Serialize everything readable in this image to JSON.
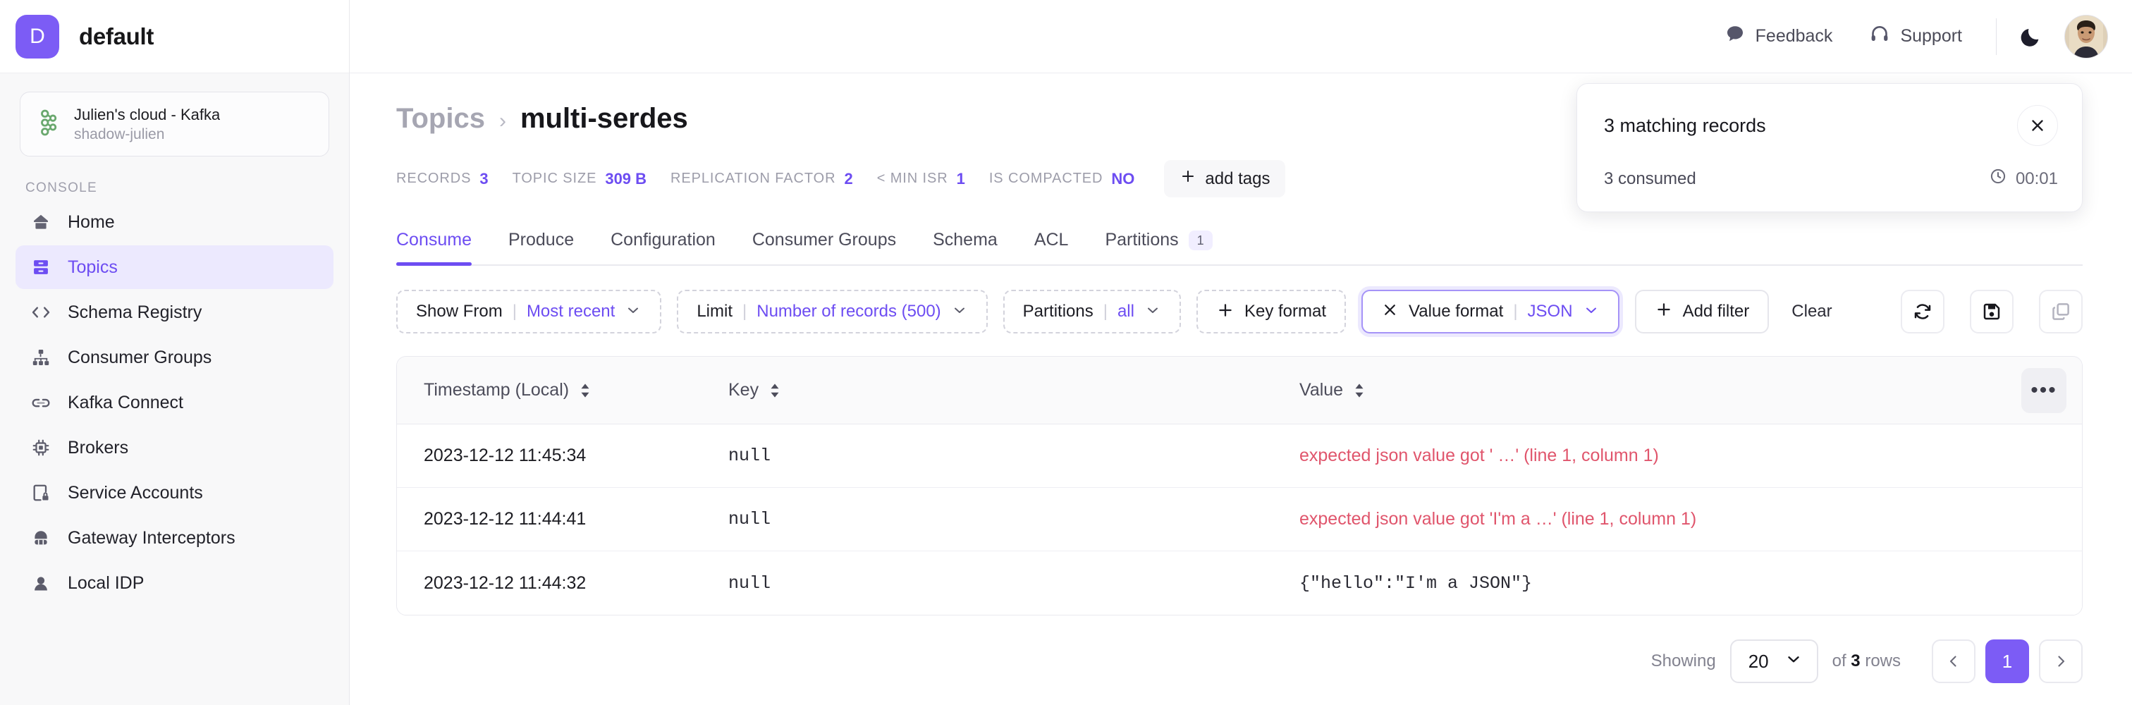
{
  "brand": {
    "initial": "D",
    "name": "default"
  },
  "cluster": {
    "title": "Julien's cloud - Kafka",
    "subtitle": "shadow-julien",
    "icon": "kafka-icon"
  },
  "sidebar": {
    "section_label": "CONSOLE",
    "items": [
      {
        "label": "Home",
        "icon": "home-icon",
        "active": false
      },
      {
        "label": "Topics",
        "icon": "topics-icon",
        "active": true
      },
      {
        "label": "Schema Registry",
        "icon": "code-brackets-icon",
        "active": false
      },
      {
        "label": "Consumer Groups",
        "icon": "hierarchy-icon",
        "active": false
      },
      {
        "label": "Kafka Connect",
        "icon": "link-icon",
        "active": false
      },
      {
        "label": "Brokers",
        "icon": "chip-icon",
        "active": false
      },
      {
        "label": "Service Accounts",
        "icon": "device-lock-icon",
        "active": false
      },
      {
        "label": "Gateway Interceptors",
        "icon": "gateway-icon",
        "active": false
      },
      {
        "label": "Local IDP",
        "icon": "idp-icon",
        "active": false
      }
    ]
  },
  "topbar": {
    "feedback_label": "Feedback",
    "support_label": "Support",
    "feedback_icon": "chat-bubble-icon",
    "support_icon": "headset-icon",
    "theme_icon": "moon-icon",
    "avatar_name": "user-avatar"
  },
  "breadcrumb": {
    "parent": "Topics",
    "separator": "›",
    "current": "multi-serdes"
  },
  "meta": [
    {
      "key": "RECORDS",
      "value": "3"
    },
    {
      "key": "TOPIC SIZE",
      "value": "309 B"
    },
    {
      "key": "REPLICATION FACTOR",
      "value": "2"
    },
    {
      "key": "< MIN ISR",
      "value": "1"
    },
    {
      "key": "IS COMPACTED",
      "value": "NO"
    }
  ],
  "add_tags_label": "add tags",
  "tabs": [
    {
      "label": "Consume",
      "active": true,
      "badge": null
    },
    {
      "label": "Produce",
      "active": false,
      "badge": null
    },
    {
      "label": "Configuration",
      "active": false,
      "badge": null
    },
    {
      "label": "Consumer Groups",
      "active": false,
      "badge": null
    },
    {
      "label": "Schema",
      "active": false,
      "badge": null
    },
    {
      "label": "ACL",
      "active": false,
      "badge": null
    },
    {
      "label": "Partitions",
      "active": false,
      "badge": "1"
    }
  ],
  "toolbar": {
    "filters": [
      {
        "style": "dashed",
        "lead_icon": null,
        "key": "Show From",
        "value": "Most recent",
        "caret": true
      },
      {
        "style": "dashed",
        "lead_icon": null,
        "key": "Limit",
        "value": "Number of records (500)",
        "caret": true
      },
      {
        "style": "dashed",
        "lead_icon": null,
        "key": "Partitions",
        "value": "all",
        "caret": true
      },
      {
        "style": "dashed",
        "lead_icon": "plus-icon",
        "key": "Key format",
        "value": null,
        "caret": false
      },
      {
        "style": "selected",
        "lead_icon": "x-icon",
        "key": "Value format",
        "value": "JSON",
        "caret": true
      }
    ],
    "add_filter_label": "Add filter",
    "clear_label": "Clear",
    "actions": [
      {
        "icon": "refresh-icon",
        "name": "refresh-button"
      },
      {
        "icon": "save-icon",
        "name": "save-button"
      },
      {
        "icon": "copy-icon",
        "name": "copy-button"
      }
    ]
  },
  "table": {
    "columns": [
      {
        "label": "Timestamp (Local)",
        "sortable": true
      },
      {
        "label": "Key",
        "sortable": true
      },
      {
        "label": "Value",
        "sortable": true
      }
    ],
    "more_label": "•••",
    "rows": [
      {
        "timestamp": "2023-12-12 11:45:34",
        "key": "null",
        "value": "expected json value got '  …' (line 1, column 1)",
        "value_is_error": true
      },
      {
        "timestamp": "2023-12-12 11:44:41",
        "key": "null",
        "value": "expected json value got 'I'm a …' (line 1, column 1)",
        "value_is_error": true
      },
      {
        "timestamp": "2023-12-12 11:44:32",
        "key": "null",
        "value": "{\"hello\":\"I'm a JSON\"}",
        "value_is_error": false
      }
    ]
  },
  "footer": {
    "showing_label": "Showing",
    "page_size": "20",
    "of_prefix": "of",
    "row_count": "3",
    "of_suffix": "rows",
    "prev_icon": "chevron-left-icon",
    "next_icon": "chevron-right-icon",
    "current_page": "1"
  },
  "toast": {
    "title": "3 matching records",
    "subtitle": "3 consumed",
    "elapsed": "00:01",
    "close_icon": "close-icon",
    "clock_icon": "clock-icon"
  },
  "colors": {
    "accent": "#6d4df2",
    "accent_solid": "#7c5cf5",
    "accent_bg": "#ece9fe",
    "error": "#e0556c",
    "kafka_green": "#6aa86e"
  }
}
